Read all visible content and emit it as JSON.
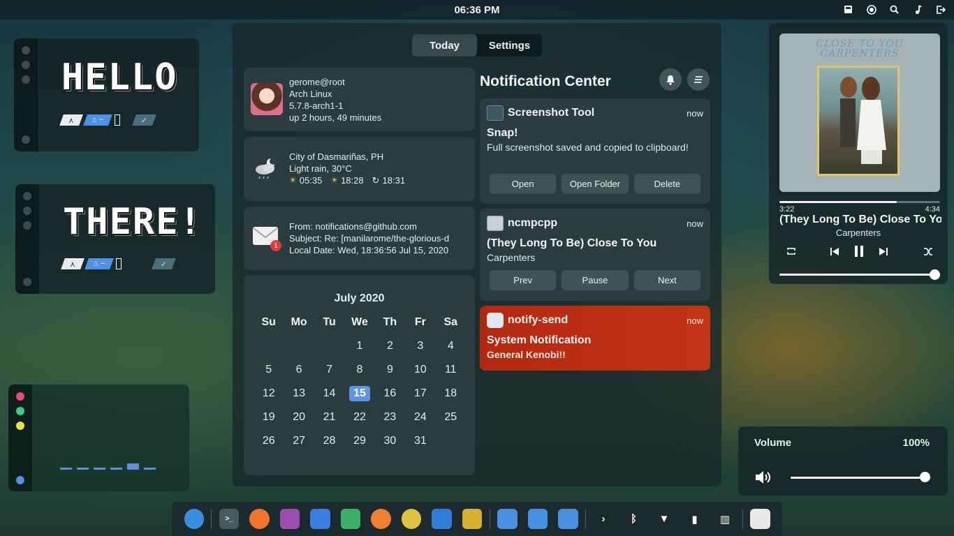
{
  "topbar": {
    "clock": "06:36 PM",
    "tray_icons": [
      "screenshot-icon",
      "record-icon",
      "search-icon",
      "music-icon",
      "logout-icon"
    ]
  },
  "widgets": {
    "hello": {
      "text": "HELLO",
      "tag_arch": "⋏",
      "tag_home": "⌂ ~",
      "tag_check": "✓"
    },
    "there": {
      "text": "THERE!",
      "tag_arch": "⋏",
      "tag_home": "⌂ ~",
      "tag_check": "✓"
    }
  },
  "dashboard": {
    "tabs": [
      {
        "label": "Today"
      },
      {
        "label": "Settings"
      }
    ],
    "system": {
      "user": "gerome@root",
      "os": "Arch Linux",
      "kernel": "5.7.8-arch1-1",
      "uptime": "up 2 hours, 49 minutes"
    },
    "weather": {
      "location": "City of Dasmariñas, PH",
      "condition": "Light rain, 30°C",
      "sunrise": "05:35",
      "sunset": "18:28",
      "refresh_time": "18:31"
    },
    "email": {
      "from": "From: notifications@github.com",
      "subject": "Subject: Re: [manilarome/the-glorious-d",
      "date": "Local Date: Wed, 18:36:56 Jul 15, 2020",
      "badge": "1"
    },
    "calendar": {
      "title": "July 2020",
      "weekdays": [
        "Su",
        "Mo",
        "Tu",
        "We",
        "Th",
        "Fr",
        "Sa"
      ],
      "days": [
        "",
        "",
        "",
        "1",
        "2",
        "3",
        "4",
        "5",
        "6",
        "7",
        "8",
        "9",
        "10",
        "11",
        "12",
        "13",
        "14",
        "15",
        "16",
        "17",
        "18",
        "19",
        "20",
        "21",
        "22",
        "23",
        "24",
        "25",
        "26",
        "27",
        "28",
        "29",
        "30",
        "31",
        ""
      ],
      "today": "15"
    },
    "notifications": {
      "title": "Notification Center",
      "items": [
        {
          "app": "Screenshot Tool",
          "time": "now",
          "title": "Snap!",
          "body": "Full screenshot saved and copied to clipboard!",
          "actions": [
            "Open",
            "Open Folder",
            "Delete"
          ]
        },
        {
          "app": "ncmpcpp",
          "time": "now",
          "title": "(They Long To Be) Close To You",
          "body": "Carpenters",
          "actions": [
            "Prev",
            "Pause",
            "Next"
          ]
        },
        {
          "app": "notify-send",
          "time": "now",
          "title": "System Notification",
          "body": "General Kenobi!!",
          "color": "#b52810"
        }
      ]
    }
  },
  "player": {
    "album_text_line1": "CLOSE TO YOU",
    "album_text_line2": "CARPENTERS",
    "elapsed": "3:22",
    "total": "4:34",
    "progress": 0.73,
    "song": "(They Long To Be) Close To You",
    "artist": "Carpenters",
    "volume_level": 1.0
  },
  "volume": {
    "label": "Volume",
    "value": "100%",
    "level": 1.0
  },
  "bars": {
    "colors": [
      "#e5487a",
      "#41c98a",
      "#e8e23a",
      "#5a8fe0"
    ],
    "levels": [
      0.3,
      0.3,
      0.3,
      0.3,
      1.0,
      0.3
    ]
  },
  "dock": {
    "items": [
      "start-icon",
      "terminal-icon",
      "firefox-icon",
      "editor-icon",
      "files-icon",
      "media-icon",
      "game-icon",
      "color-picker-icon",
      "virtualbox-icon",
      "settings-icon",
      "home-folder-icon",
      "documents-folder-icon",
      "downloads-folder-icon",
      "expand-icon",
      "bluetooth-icon",
      "wifi-icon",
      "battery-icon",
      "layout-icon",
      "trash-icon"
    ]
  }
}
